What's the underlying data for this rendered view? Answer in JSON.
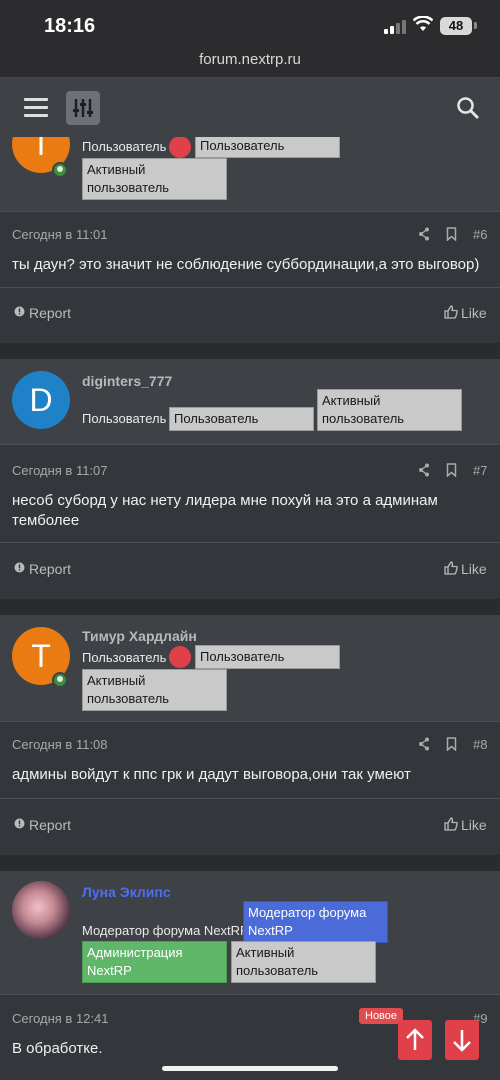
{
  "status": {
    "time": "18:16",
    "battery": "48"
  },
  "url": "forum.nextrp.ru",
  "posts": [
    {
      "avatar_letter": "T",
      "avatar_color": "#ea7a12",
      "username": "",
      "user_title": "Пользователь",
      "badges": [
        "Пользователь",
        "Активный пользователь"
      ],
      "date": "Сегодня в 11:01",
      "number": "#6",
      "message": "ты даун? это значит не соблюдение суббординации,а это выговор)",
      "report": "Report",
      "like": "Like"
    },
    {
      "avatar_letter": "D",
      "avatar_color": "#1f82c8",
      "username": "diginters_777",
      "user_title": "Пользователь",
      "badges": [
        "Пользователь",
        "Активный пользователь"
      ],
      "date": "Сегодня в 11:07",
      "number": "#7",
      "message": "несоб суборд у нас нету лидера мне похуй на это а админам темболее",
      "report": "Report",
      "like": "Like"
    },
    {
      "avatar_letter": "T",
      "avatar_color": "#ea7a12",
      "username": "Тимур Хардлайн",
      "user_title": "Пользователь",
      "badges": [
        "Пользователь",
        "Активный пользователь"
      ],
      "date": "Сегодня в 11:08",
      "number": "#8",
      "message": "админы войдут к ппс грк и дадут выговора,они так умеют",
      "report": "Report",
      "like": "Like"
    },
    {
      "username": "Луна Эклипс",
      "username_color": "#4f6ef0",
      "user_title": "Модератор форума NextRP",
      "badges": [
        "Модератор форума NextRP",
        "Администрация NextRP",
        "Активный пользователь"
      ],
      "date": "Сегодня в 12:41",
      "new_badge": "Новое",
      "number": "#9",
      "message": "В обработке."
    }
  ],
  "icons": [
    "hamburger-icon",
    "filter-icon",
    "search-icon",
    "share-icon",
    "bookmark-icon",
    "report-icon",
    "like-icon",
    "scroll-up-icon",
    "scroll-down-icon"
  ]
}
